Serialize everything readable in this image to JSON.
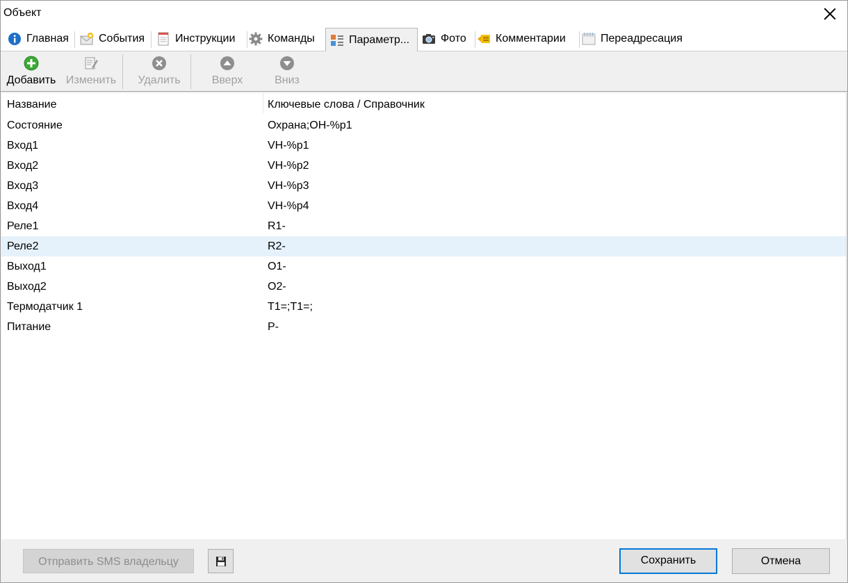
{
  "window": {
    "title": "Объект"
  },
  "tabs": [
    {
      "label": "Главная"
    },
    {
      "label": "События"
    },
    {
      "label": "Инструкции"
    },
    {
      "label": "Команды"
    },
    {
      "label": "Параметр..."
    },
    {
      "label": "Фото"
    },
    {
      "label": "Комментарии"
    },
    {
      "label": "Переадресация"
    }
  ],
  "active_tab": "Параметр...",
  "toolbar": {
    "add_label": "Добавить",
    "edit_label": "Изменить",
    "delete_label": "Удалить",
    "up_label": "Вверх",
    "down_label": "Вниз"
  },
  "table": {
    "columns": [
      "Название",
      "Ключевые слова / Справочник"
    ],
    "rows": [
      {
        "name": "Состояние",
        "keywords": "Охрана;ОН-%p1"
      },
      {
        "name": "Вход1",
        "keywords": "VH-%p1"
      },
      {
        "name": "Вход2",
        "keywords": "VH-%p2"
      },
      {
        "name": "Вход3",
        "keywords": "VH-%p3"
      },
      {
        "name": "Вход4",
        "keywords": "VH-%p4"
      },
      {
        "name": "Реле1",
        "keywords": "R1-"
      },
      {
        "name": "Реле2",
        "keywords": "R2-"
      },
      {
        "name": "Выход1",
        "keywords": "O1-"
      },
      {
        "name": "Выход2",
        "keywords": "O2-"
      },
      {
        "name": "Термодатчик 1",
        "keywords": "T1=;T1=;"
      },
      {
        "name": "Питание",
        "keywords": "P-"
      }
    ],
    "selected_row": "Реле2"
  },
  "footer": {
    "sms_label": "Отправить SMS владельцу",
    "save_label": "Сохранить",
    "cancel_label": "Отмена"
  },
  "colors": {
    "accent": "#0078d7",
    "selection": "#e5f1fb",
    "add_green": "#3aa935",
    "disabled_icon": "#8e8e8e"
  }
}
